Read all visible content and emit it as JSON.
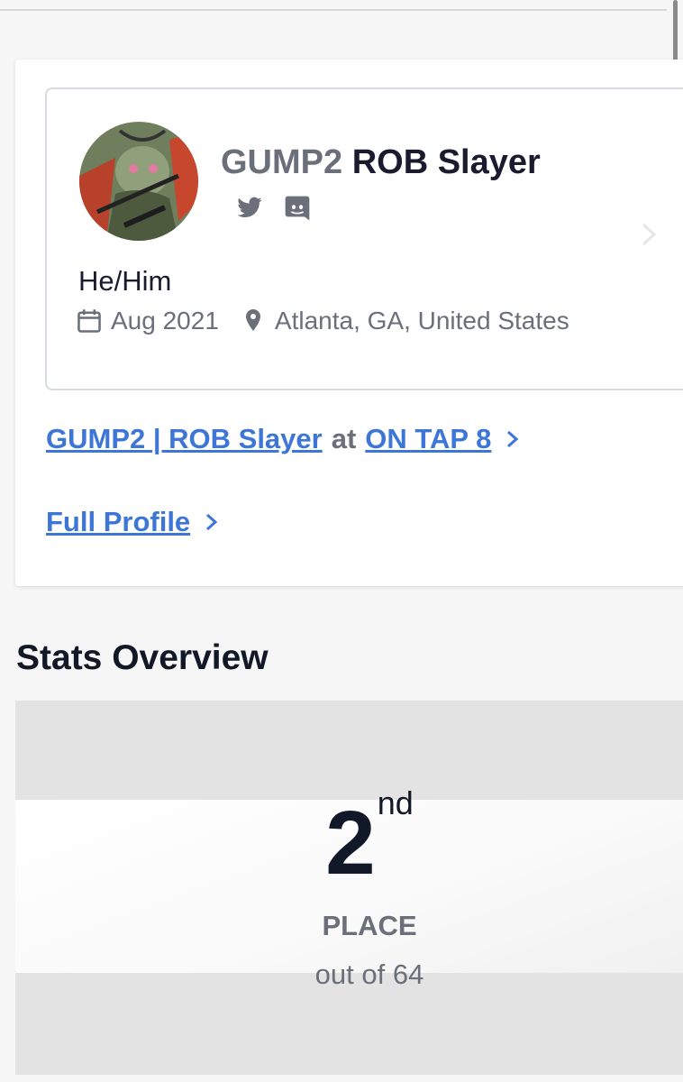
{
  "profile": {
    "prefix": "GUMP2",
    "gamertag": "ROB Slayer",
    "pronouns": "He/Him",
    "joined": "Aug 2021",
    "location": "Atlanta, GA, United States",
    "socials": [
      "twitter-icon",
      "discord-icon"
    ]
  },
  "links": {
    "tournament": {
      "player_label": "GUMP2 | ROB Slayer",
      "connector": "at",
      "event_label": "ON TAP 8"
    },
    "full_profile_label": "Full Profile"
  },
  "stats": {
    "title": "Stats Overview",
    "place_number": "2",
    "place_suffix": "nd",
    "place_label": "PLACE",
    "out_of": "out of 64"
  },
  "colors": {
    "link": "#3d76d6",
    "muted": "#6b6f7a",
    "dark": "#1b1b2f"
  }
}
